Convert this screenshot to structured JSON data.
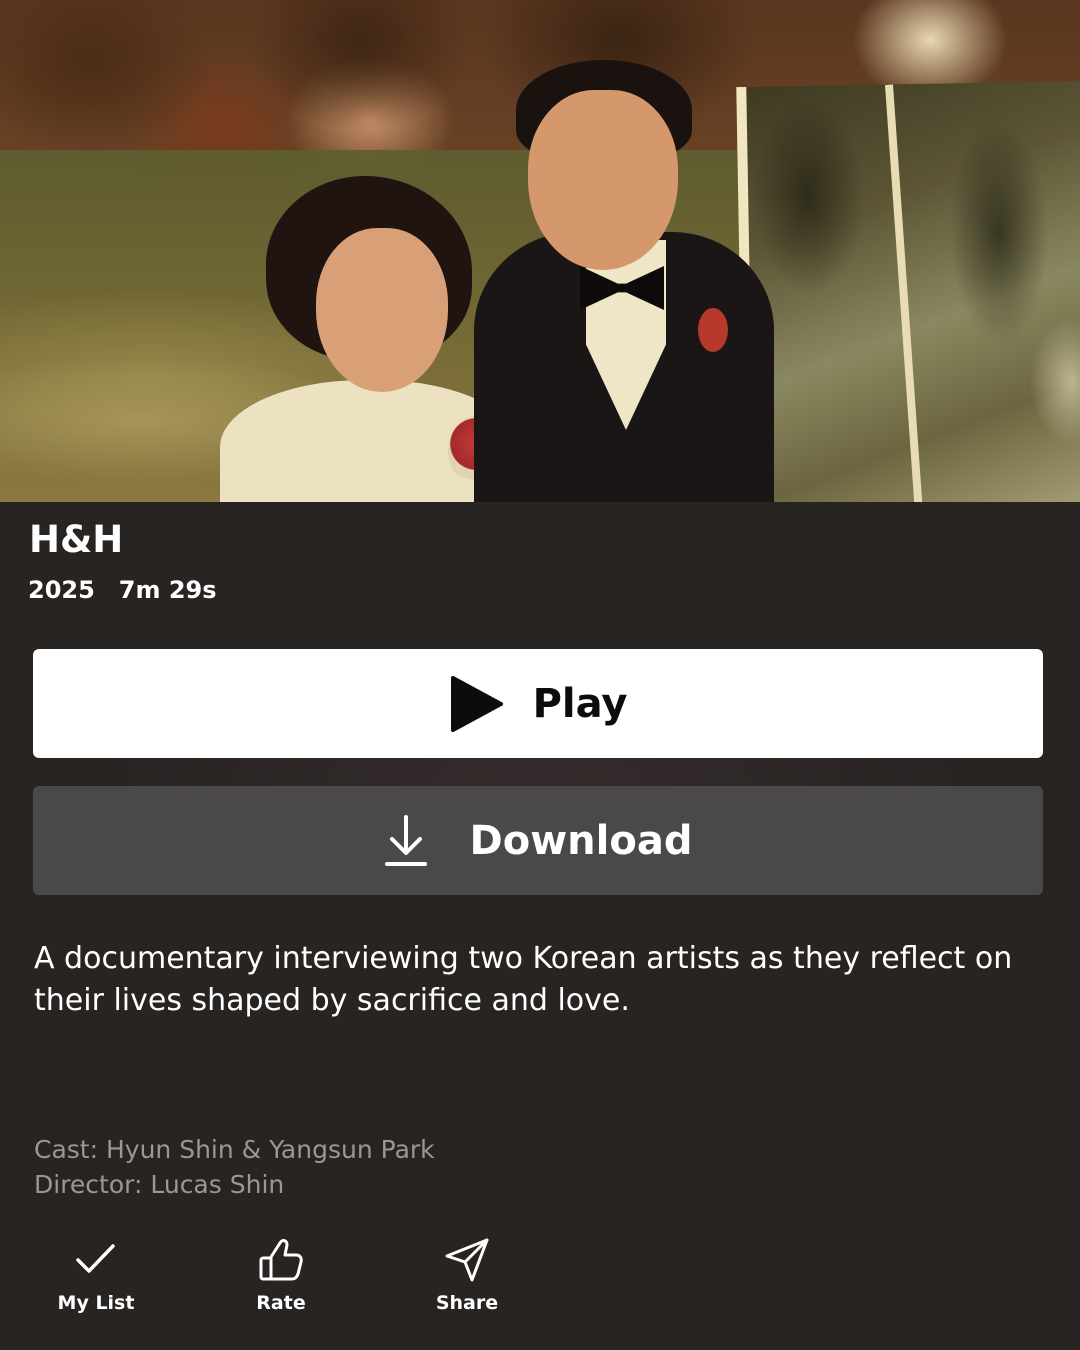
{
  "title": {
    "name": "H&H"
  },
  "meta": {
    "year": "2025",
    "duration": "7m 29s"
  },
  "buttons": {
    "play_label": "Play",
    "download_label": "Download"
  },
  "description": "A documentary interviewing two Korean artists as they reflect on their lives shaped by sacrifice and love.",
  "credits": {
    "cast": "Cast: Hyun Shin & Yangsun Park",
    "director": "Director: Lucas Shin"
  },
  "bottom_actions": [
    {
      "label": "My List",
      "icon": "check-icon"
    },
    {
      "label": "Rate",
      "icon": "thumbs-up-icon"
    },
    {
      "label": "Share",
      "icon": "send-icon"
    }
  ],
  "colors": {
    "background": "#272422",
    "play_button": "#ffffff",
    "download_button": "#4a4849",
    "secondary_text": "#9a9896"
  }
}
